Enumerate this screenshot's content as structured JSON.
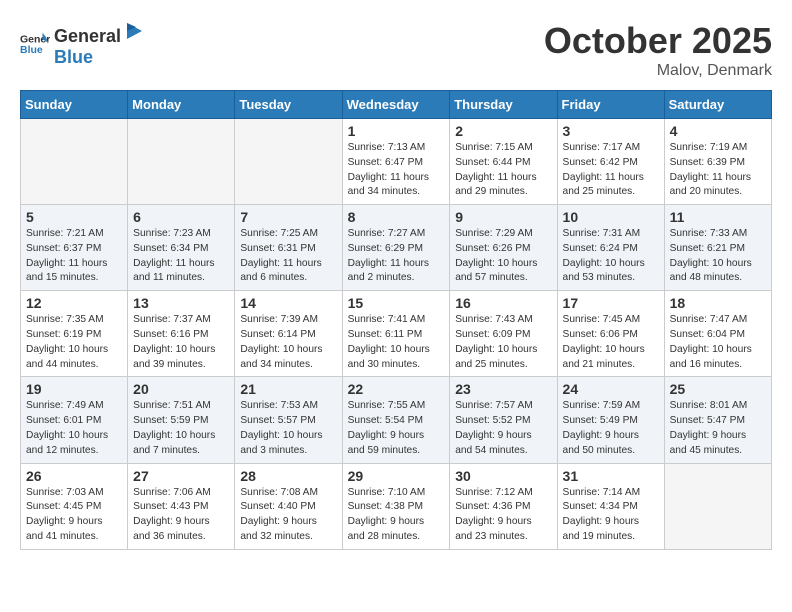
{
  "header": {
    "logo_general": "General",
    "logo_blue": "Blue",
    "month": "October 2025",
    "location": "Malov, Denmark"
  },
  "weekdays": [
    "Sunday",
    "Monday",
    "Tuesday",
    "Wednesday",
    "Thursday",
    "Friday",
    "Saturday"
  ],
  "weeks": [
    [
      {
        "day": "",
        "info": ""
      },
      {
        "day": "",
        "info": ""
      },
      {
        "day": "",
        "info": ""
      },
      {
        "day": "1",
        "info": "Sunrise: 7:13 AM\nSunset: 6:47 PM\nDaylight: 11 hours\nand 34 minutes."
      },
      {
        "day": "2",
        "info": "Sunrise: 7:15 AM\nSunset: 6:44 PM\nDaylight: 11 hours\nand 29 minutes."
      },
      {
        "day": "3",
        "info": "Sunrise: 7:17 AM\nSunset: 6:42 PM\nDaylight: 11 hours\nand 25 minutes."
      },
      {
        "day": "4",
        "info": "Sunrise: 7:19 AM\nSunset: 6:39 PM\nDaylight: 11 hours\nand 20 minutes."
      }
    ],
    [
      {
        "day": "5",
        "info": "Sunrise: 7:21 AM\nSunset: 6:37 PM\nDaylight: 11 hours\nand 15 minutes."
      },
      {
        "day": "6",
        "info": "Sunrise: 7:23 AM\nSunset: 6:34 PM\nDaylight: 11 hours\nand 11 minutes."
      },
      {
        "day": "7",
        "info": "Sunrise: 7:25 AM\nSunset: 6:31 PM\nDaylight: 11 hours\nand 6 minutes."
      },
      {
        "day": "8",
        "info": "Sunrise: 7:27 AM\nSunset: 6:29 PM\nDaylight: 11 hours\nand 2 minutes."
      },
      {
        "day": "9",
        "info": "Sunrise: 7:29 AM\nSunset: 6:26 PM\nDaylight: 10 hours\nand 57 minutes."
      },
      {
        "day": "10",
        "info": "Sunrise: 7:31 AM\nSunset: 6:24 PM\nDaylight: 10 hours\nand 53 minutes."
      },
      {
        "day": "11",
        "info": "Sunrise: 7:33 AM\nSunset: 6:21 PM\nDaylight: 10 hours\nand 48 minutes."
      }
    ],
    [
      {
        "day": "12",
        "info": "Sunrise: 7:35 AM\nSunset: 6:19 PM\nDaylight: 10 hours\nand 44 minutes."
      },
      {
        "day": "13",
        "info": "Sunrise: 7:37 AM\nSunset: 6:16 PM\nDaylight: 10 hours\nand 39 minutes."
      },
      {
        "day": "14",
        "info": "Sunrise: 7:39 AM\nSunset: 6:14 PM\nDaylight: 10 hours\nand 34 minutes."
      },
      {
        "day": "15",
        "info": "Sunrise: 7:41 AM\nSunset: 6:11 PM\nDaylight: 10 hours\nand 30 minutes."
      },
      {
        "day": "16",
        "info": "Sunrise: 7:43 AM\nSunset: 6:09 PM\nDaylight: 10 hours\nand 25 minutes."
      },
      {
        "day": "17",
        "info": "Sunrise: 7:45 AM\nSunset: 6:06 PM\nDaylight: 10 hours\nand 21 minutes."
      },
      {
        "day": "18",
        "info": "Sunrise: 7:47 AM\nSunset: 6:04 PM\nDaylight: 10 hours\nand 16 minutes."
      }
    ],
    [
      {
        "day": "19",
        "info": "Sunrise: 7:49 AM\nSunset: 6:01 PM\nDaylight: 10 hours\nand 12 minutes."
      },
      {
        "day": "20",
        "info": "Sunrise: 7:51 AM\nSunset: 5:59 PM\nDaylight: 10 hours\nand 7 minutes."
      },
      {
        "day": "21",
        "info": "Sunrise: 7:53 AM\nSunset: 5:57 PM\nDaylight: 10 hours\nand 3 minutes."
      },
      {
        "day": "22",
        "info": "Sunrise: 7:55 AM\nSunset: 5:54 PM\nDaylight: 9 hours\nand 59 minutes."
      },
      {
        "day": "23",
        "info": "Sunrise: 7:57 AM\nSunset: 5:52 PM\nDaylight: 9 hours\nand 54 minutes."
      },
      {
        "day": "24",
        "info": "Sunrise: 7:59 AM\nSunset: 5:49 PM\nDaylight: 9 hours\nand 50 minutes."
      },
      {
        "day": "25",
        "info": "Sunrise: 8:01 AM\nSunset: 5:47 PM\nDaylight: 9 hours\nand 45 minutes."
      }
    ],
    [
      {
        "day": "26",
        "info": "Sunrise: 7:03 AM\nSunset: 4:45 PM\nDaylight: 9 hours\nand 41 minutes."
      },
      {
        "day": "27",
        "info": "Sunrise: 7:06 AM\nSunset: 4:43 PM\nDaylight: 9 hours\nand 36 minutes."
      },
      {
        "day": "28",
        "info": "Sunrise: 7:08 AM\nSunset: 4:40 PM\nDaylight: 9 hours\nand 32 minutes."
      },
      {
        "day": "29",
        "info": "Sunrise: 7:10 AM\nSunset: 4:38 PM\nDaylight: 9 hours\nand 28 minutes."
      },
      {
        "day": "30",
        "info": "Sunrise: 7:12 AM\nSunset: 4:36 PM\nDaylight: 9 hours\nand 23 minutes."
      },
      {
        "day": "31",
        "info": "Sunrise: 7:14 AM\nSunset: 4:34 PM\nDaylight: 9 hours\nand 19 minutes."
      },
      {
        "day": "",
        "info": ""
      }
    ]
  ]
}
